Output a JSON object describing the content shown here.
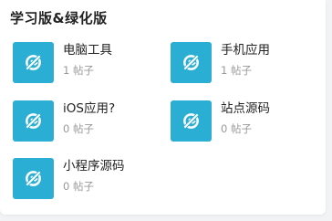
{
  "section": {
    "title": "学习版&绿化版"
  },
  "forums": [
    {
      "name": "电脑工具",
      "count": "1 帖子"
    },
    {
      "name": "手机应用",
      "count": "1 帖子"
    },
    {
      "name": "iOS应用?",
      "count": "0 帖子"
    },
    {
      "name": "站点源码",
      "count": "0 帖子"
    },
    {
      "name": "小程序源码",
      "count": "0 帖子"
    }
  ],
  "colors": {
    "icon_background": "#2aaed3",
    "icon_glyph": "#ffffff"
  },
  "icon": "no-image-icon"
}
